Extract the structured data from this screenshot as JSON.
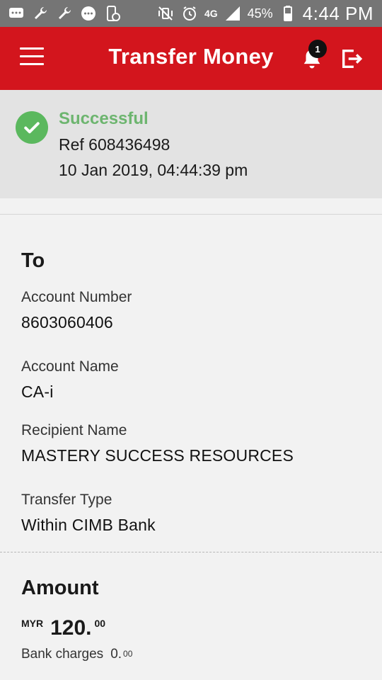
{
  "status_bar": {
    "network": "4G",
    "battery": "45%",
    "time": "4:44 PM"
  },
  "app_bar": {
    "title": "Transfer Money",
    "notification_count": "1"
  },
  "result": {
    "status": "Successful",
    "reference": "Ref 608436498",
    "datetime": "10 Jan 2019, 04:44:39 pm"
  },
  "to_section": {
    "title": "To",
    "fields": [
      {
        "label": "Account Number",
        "value": "8603060406"
      },
      {
        "label": "Account Name",
        "value": "CA-i"
      },
      {
        "label": "Recipient Name",
        "value": "MASTERY SUCCESS RESOURCES"
      },
      {
        "label": "Transfer Type",
        "value": "Within CIMB Bank"
      }
    ]
  },
  "amount_section": {
    "title": "Amount",
    "currency": "MYR",
    "amount_whole": "120.",
    "amount_cents": "00",
    "charges_label": "Bank charges",
    "charges_whole": "0.",
    "charges_cents": "00"
  },
  "colors": {
    "brand_red": "#d3151d",
    "success_green": "#5bb85e",
    "status_bar": "#757575"
  }
}
